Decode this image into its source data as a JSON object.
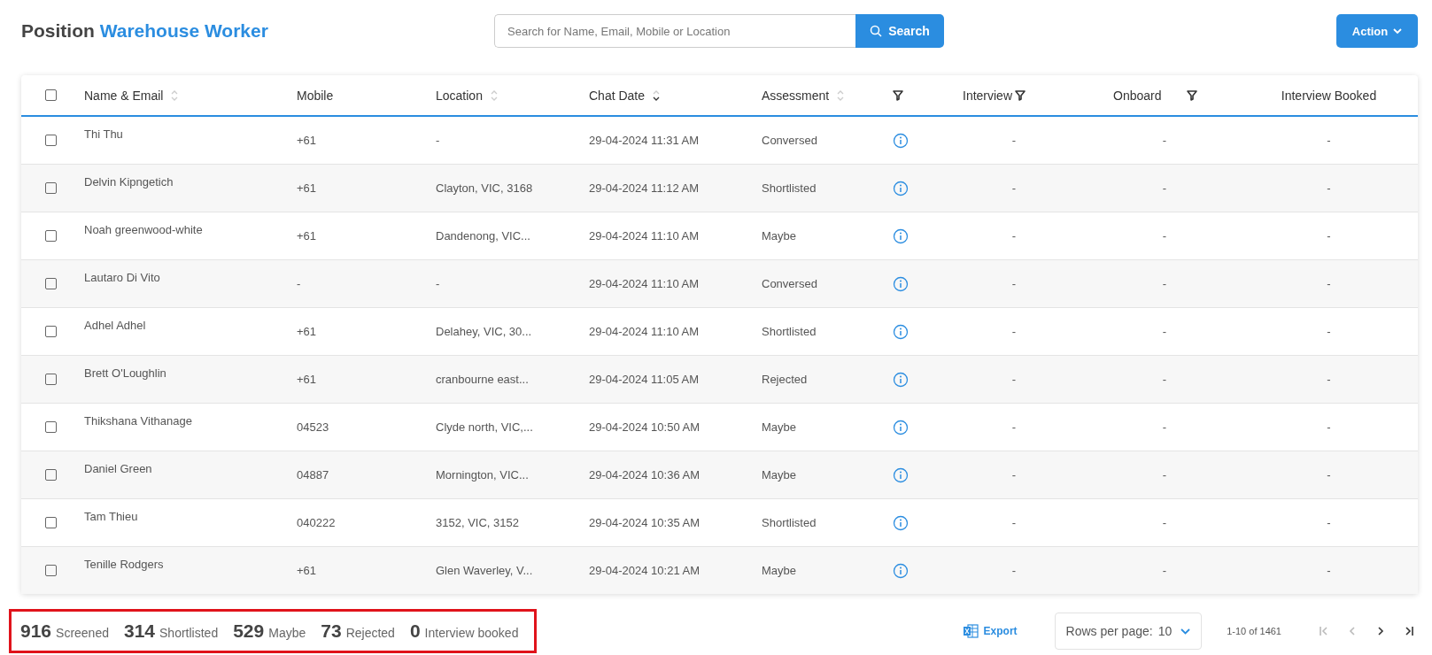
{
  "header": {
    "title_prefix": "Position",
    "title_position": "Warehouse Worker",
    "search": {
      "placeholder": "Search for Name, Email, Mobile or Location",
      "button": "Search"
    },
    "action_button": "Action"
  },
  "table": {
    "select_all": {
      "checked": false
    },
    "columns": [
      {
        "label": "Name & Email",
        "sortable": true,
        "sorted_desc": false,
        "filter": false
      },
      {
        "label": "Mobile",
        "sortable": false,
        "filter": false
      },
      {
        "label": "Location",
        "sortable": true,
        "sorted_desc": false,
        "filter": false
      },
      {
        "label": "Chat Date",
        "sortable": true,
        "sorted_desc": true,
        "filter": false
      },
      {
        "label": "Assessment",
        "sortable": true,
        "sorted_desc": false,
        "filter": true
      },
      {
        "label": "Interview",
        "sortable": false,
        "filter": true
      },
      {
        "label": "Onboard",
        "sortable": false,
        "filter": true
      },
      {
        "label": "Interview Booked",
        "sortable": false,
        "filter": false
      }
    ],
    "rows": [
      {
        "checked": false,
        "name": "Thi Thu",
        "mobile": "+61",
        "location": "-",
        "chat_date": "29-04-2024 11:31 AM",
        "assessment": "Conversed",
        "interview": "-",
        "onboard": "-",
        "interview_booked": "-"
      },
      {
        "checked": false,
        "name": "Delvin Kipngetich",
        "mobile": "+61",
        "location": "Clayton, VIC, 3168",
        "chat_date": "29-04-2024 11:12 AM",
        "assessment": "Shortlisted",
        "interview": "-",
        "onboard": "-",
        "interview_booked": "-"
      },
      {
        "checked": false,
        "name": "Noah greenwood-white",
        "mobile": "+61",
        "location": "Dandenong, VIC...",
        "chat_date": "29-04-2024 11:10 AM",
        "assessment": "Maybe",
        "interview": "-",
        "onboard": "-",
        "interview_booked": "-"
      },
      {
        "checked": false,
        "name": "Lautaro Di Vito",
        "mobile": "-",
        "location": "-",
        "chat_date": "29-04-2024 11:10 AM",
        "assessment": "Conversed",
        "interview": "-",
        "onboard": "-",
        "interview_booked": "-"
      },
      {
        "checked": false,
        "name": "Adhel Adhel",
        "mobile": "+61",
        "location": "Delahey, VIC, 30...",
        "chat_date": "29-04-2024 11:10 AM",
        "assessment": "Shortlisted",
        "interview": "-",
        "onboard": "-",
        "interview_booked": "-"
      },
      {
        "checked": false,
        "name": "Brett O'Loughlin",
        "mobile": "+61",
        "location": "cranbourne east...",
        "chat_date": "29-04-2024 11:05 AM",
        "assessment": "Rejected",
        "interview": "-",
        "onboard": "-",
        "interview_booked": "-"
      },
      {
        "checked": false,
        "name": "Thikshana Vithanage",
        "mobile": "04523",
        "location": "Clyde north, VIC,...",
        "chat_date": "29-04-2024 10:50 AM",
        "assessment": "Maybe",
        "interview": "-",
        "onboard": "-",
        "interview_booked": "-"
      },
      {
        "checked": false,
        "name": "Daniel Green",
        "mobile": "04887",
        "location": "Mornington, VIC...",
        "chat_date": "29-04-2024 10:36 AM",
        "assessment": "Maybe",
        "interview": "-",
        "onboard": "-",
        "interview_booked": "-"
      },
      {
        "checked": false,
        "name": "Tam Thieu",
        "mobile": "040222",
        "location": "3152, VIC, 3152",
        "chat_date": "29-04-2024 10:35 AM",
        "assessment": "Shortlisted",
        "interview": "-",
        "onboard": "-",
        "interview_booked": "-"
      },
      {
        "checked": false,
        "name": "Tenille Rodgers",
        "mobile": "+61",
        "location": "Glen Waverley, V...",
        "chat_date": "29-04-2024 10:21 AM",
        "assessment": "Maybe",
        "interview": "-",
        "onboard": "-",
        "interview_booked": "-"
      }
    ]
  },
  "footer": {
    "stats": [
      {
        "count": "916",
        "label": "Screened"
      },
      {
        "count": "314",
        "label": "Shortlisted"
      },
      {
        "count": "529",
        "label": "Maybe"
      },
      {
        "count": "73",
        "label": "Rejected"
      },
      {
        "count": "0",
        "label": "Interview booked"
      }
    ],
    "export": "Export",
    "rows_per_page": {
      "label": "Rows per page:",
      "value": "10"
    },
    "range": "1-10 of 1461",
    "pager": [
      {
        "kind": "first",
        "disabled": true
      },
      {
        "kind": "prev",
        "disabled": true
      },
      {
        "kind": "next",
        "disabled": false
      },
      {
        "kind": "last",
        "disabled": false
      }
    ]
  }
}
